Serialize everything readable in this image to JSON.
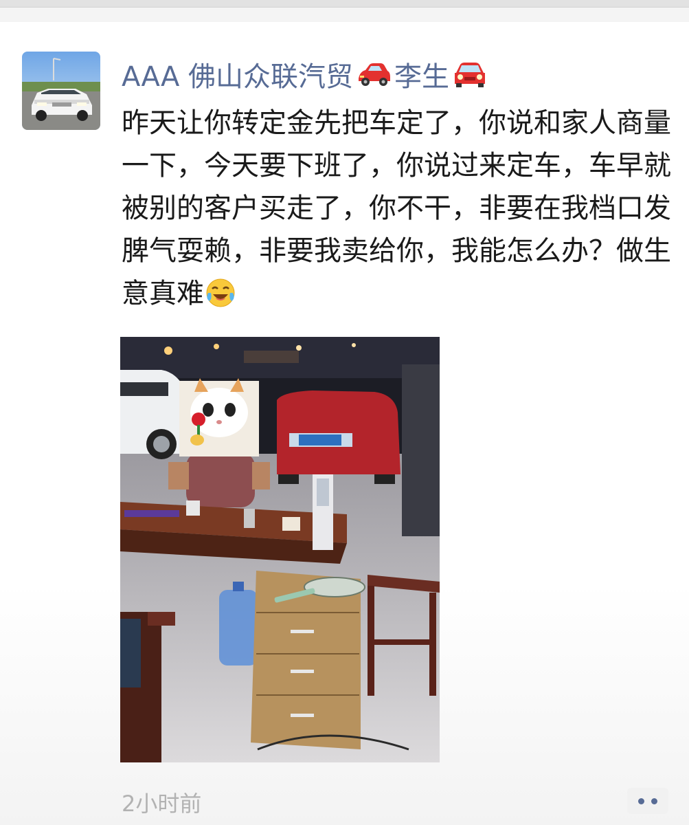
{
  "post": {
    "poster_name_prefix": "AAA 佛山众联汽贸",
    "poster_name_suffix": "李生",
    "text": "昨天让你转定金先把车定了，你说和家人商量一下，今天要下班了，你说过来定车，车早就被别的客户买走了，你不干，非要在我档口发脾气耍赖，非要我卖给你，我能怎么办？做生意真难",
    "timestamp": "2小时前",
    "icons": [
      "red-car-emoji",
      "car-front-emoji",
      "laughing-crying-emoji",
      "more-dots-icon"
    ],
    "colors": {
      "name_link": "#576b95",
      "text": "#1a1a1a",
      "timestamp": "#b2b2b2"
    }
  }
}
